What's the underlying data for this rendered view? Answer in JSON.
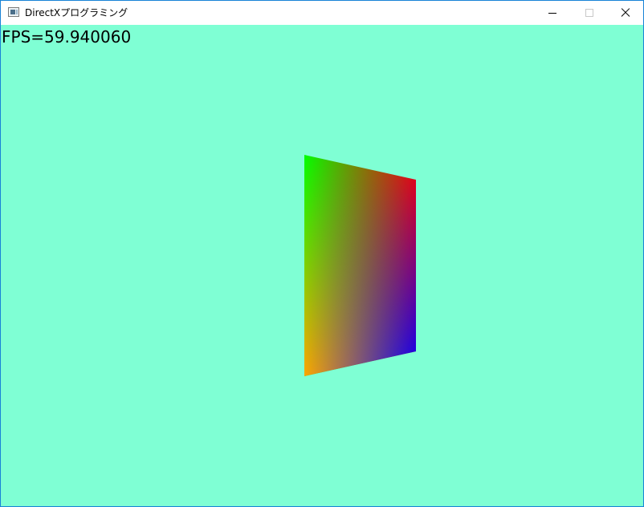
{
  "window": {
    "title": "DirectXプログラミング",
    "icon": "app-window-icon",
    "controls": {
      "minimize": "minimize-icon",
      "maximize": "maximize-icon",
      "close": "close-icon"
    }
  },
  "viewport": {
    "background_color": "#7fffd4",
    "fps_text": "FPS=59.940060"
  },
  "scene": {
    "object": "colored-quad",
    "vertex_colors": {
      "top_left": "#00ff00",
      "top_right": "#ff0000",
      "bottom_right": "#0000ff",
      "bottom_left": "#ffa500"
    }
  }
}
